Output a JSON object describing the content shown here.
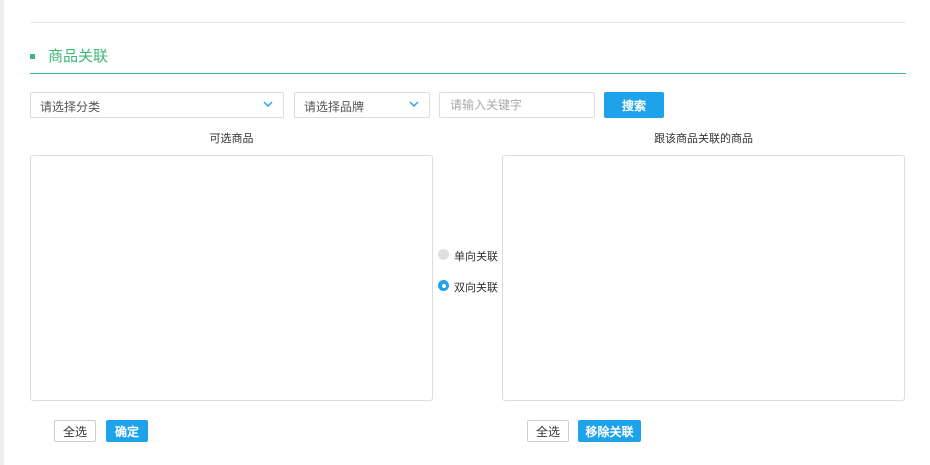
{
  "section": {
    "title": "商品关联"
  },
  "filters": {
    "category_select": "请选择分类",
    "brand_select": "请选择品牌",
    "keyword_placeholder": "请输入关键字",
    "search_label": "搜索"
  },
  "left_panel": {
    "title": "可选商品",
    "select_all_label": "全选",
    "confirm_label": "确定"
  },
  "right_panel": {
    "title": "跟该商品关联的商品",
    "select_all_label": "全选",
    "remove_label": "移除关联"
  },
  "relation": {
    "options": [
      {
        "label": "单向关联",
        "selected": false
      },
      {
        "label": "双向关联",
        "selected": true
      }
    ]
  },
  "colors": {
    "accent": "#1ea2ea",
    "section": "#3cb878",
    "border": "#dcdcdc"
  },
  "icons": {
    "dropdown": "chevron-down-icon"
  }
}
